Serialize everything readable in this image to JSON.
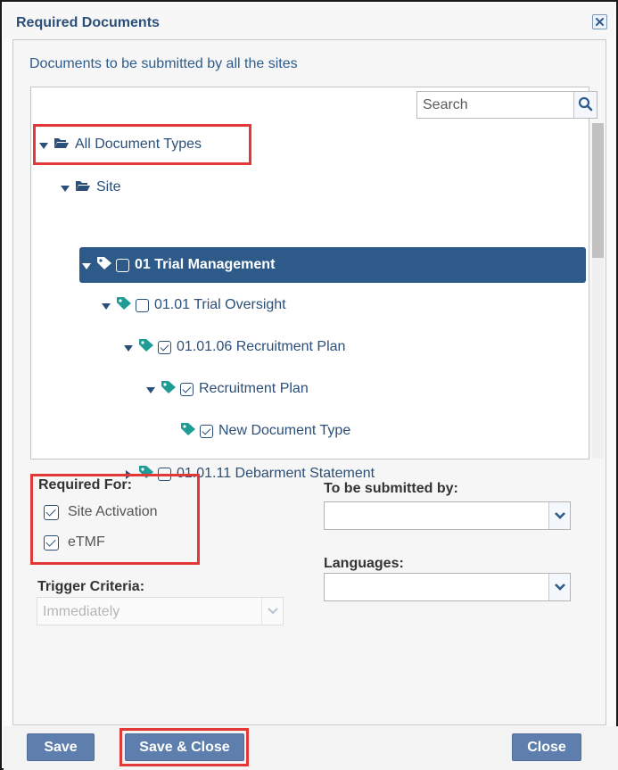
{
  "dialog": {
    "title": "Required Documents",
    "close_icon": "close-x-icon"
  },
  "content": {
    "subtitle": "Documents to be submitted by all the sites"
  },
  "search": {
    "placeholder": "Search",
    "icon": "search-icon"
  },
  "tree": {
    "nodes": [
      {
        "label": "All Document Types",
        "type": "folder",
        "expanded": true,
        "checkbox": null
      },
      {
        "label": "Site",
        "type": "folder",
        "expanded": true,
        "checkbox": null
      },
      {
        "label": "01 Trial Management",
        "type": "tag",
        "expanded": true,
        "checkbox": false,
        "selected": true
      },
      {
        "label": "01.01 Trial Oversight",
        "type": "tag",
        "expanded": true,
        "checkbox": false
      },
      {
        "label": "01.01.06 Recruitment Plan",
        "type": "tag",
        "expanded": true,
        "checkbox": true
      },
      {
        "label": "Recruitment Plan",
        "type": "tag",
        "expanded": true,
        "checkbox": true
      },
      {
        "label": "New Document Type",
        "type": "tag",
        "expanded": null,
        "checkbox": true
      },
      {
        "label": "01.01.11 Debarment Statement",
        "type": "tag",
        "expanded": false,
        "checkbox": false
      }
    ]
  },
  "required_for": {
    "label": "Required For:",
    "options": [
      {
        "label": "Site Activation",
        "checked": true
      },
      {
        "label": "eTMF",
        "checked": true
      }
    ]
  },
  "submitted_by": {
    "label": "To be submitted by:",
    "value": ""
  },
  "languages": {
    "label": "Languages:",
    "value": ""
  },
  "trigger": {
    "label": "Trigger Criteria:",
    "value": "Immediately",
    "disabled": true
  },
  "footer": {
    "save_label": "Save",
    "save_close_label": "Save & Close",
    "close_label": "Close"
  },
  "colors": {
    "accent": "#2e5a8a",
    "button": "#5e7fae",
    "tag_icon": "#1e9c95",
    "highlight_box": "#e23838"
  }
}
